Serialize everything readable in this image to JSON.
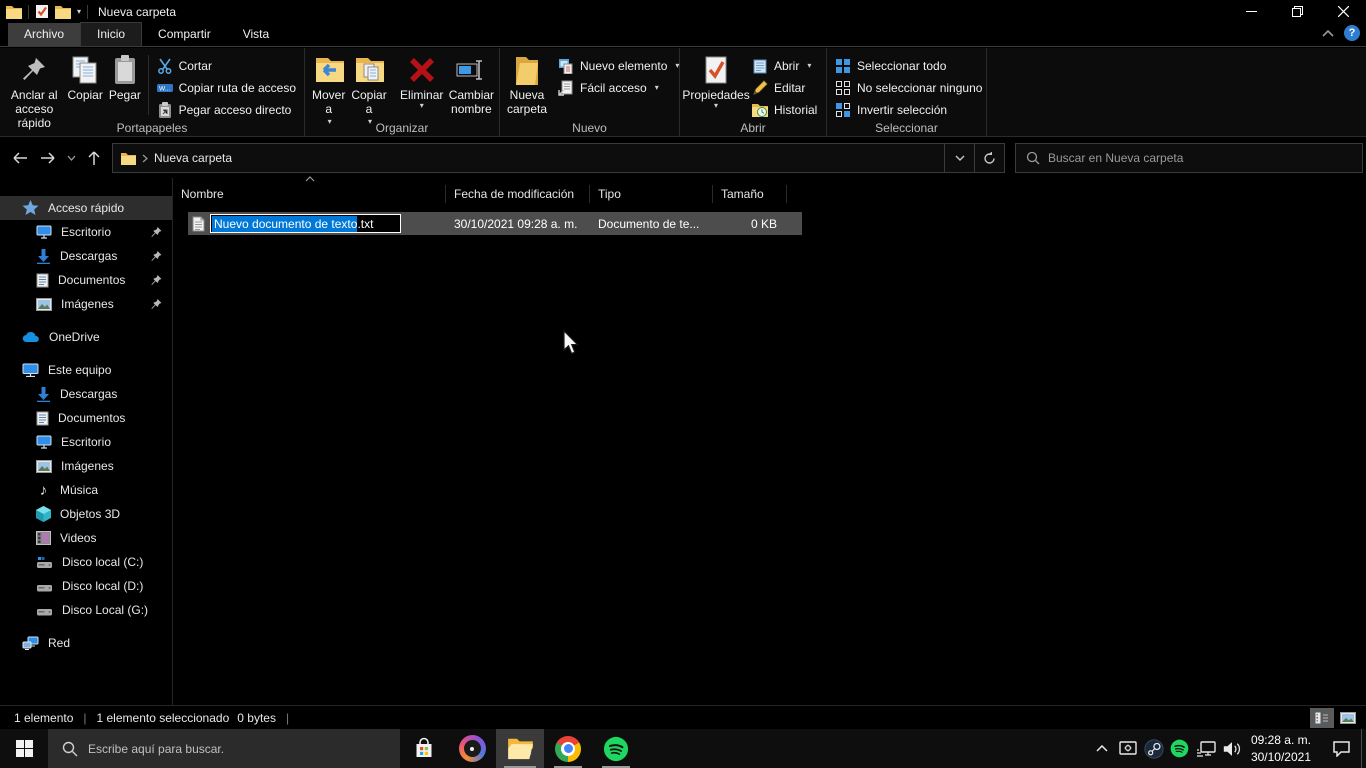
{
  "colors": {
    "accent": "#0078d7",
    "selection_blue": "#0078d7",
    "folder_yellow": "#f3c94f",
    "row_selected_bg": "#4d4d4d",
    "delete_red": "#c1121f"
  },
  "icons": {
    "dropdown_caret": "▾",
    "music_note": "♪",
    "help": "?",
    "close": "✕",
    "minimize": "–"
  },
  "titlebar": {
    "title": "Nueva carpeta"
  },
  "tabs": {
    "archivo": "Archivo",
    "inicio": "Inicio",
    "compartir": "Compartir",
    "vista": "Vista"
  },
  "ribbon": {
    "clipboard": {
      "label": "Portapapeles",
      "pin": "Anclar al acceso rápido",
      "copy": "Copiar",
      "paste": "Pegar",
      "cut": "Cortar",
      "copy_path": "Copiar ruta de acceso",
      "paste_shortcut": "Pegar acceso directo"
    },
    "organize": {
      "label": "Organizar",
      "move_to": "Mover a",
      "copy_to": "Copiar a",
      "delete": "Eliminar",
      "rename": "Cambiar nombre"
    },
    "new": {
      "label": "Nuevo",
      "new_folder": "Nueva carpeta",
      "new_item": "Nuevo elemento",
      "easy_access": "Fácil acceso"
    },
    "open": {
      "label": "Abrir",
      "properties": "Propiedades",
      "open": "Abrir",
      "edit": "Editar",
      "history": "Historial"
    },
    "select": {
      "label": "Seleccionar",
      "select_all": "Seleccionar todo",
      "select_none": "No seleccionar ninguno",
      "invert": "Invertir selección"
    }
  },
  "navbar": {
    "breadcrumb": "Nueva carpeta",
    "search_placeholder": "Buscar en Nueva carpeta"
  },
  "sidebar": {
    "quick_access": "Acceso rápido",
    "qa_items": [
      "Escritorio",
      "Descargas",
      "Documentos",
      "Imágenes"
    ],
    "onedrive": "OneDrive",
    "this_pc": "Este equipo",
    "pc_items": [
      "Descargas",
      "Documentos",
      "Escritorio",
      "Imágenes",
      "Música",
      "Objetos 3D",
      "Videos",
      "Disco local (C:)",
      "Disco local (D:)",
      "Disco Local (G:)"
    ],
    "network": "Red"
  },
  "content": {
    "columns": {
      "name": "Nombre",
      "modified": "Fecha de modificación",
      "type": "Tipo",
      "size": "Tamaño"
    },
    "file": {
      "name": "Nuevo documento de texto",
      "extension": ".txt",
      "modified": "30/10/2021 09:28 a. m.",
      "type": "Documento de te...",
      "size": "0 KB"
    }
  },
  "statusbar": {
    "count": "1 elemento",
    "selected": "1 elemento seleccionado",
    "size": "0 bytes"
  },
  "taskbar": {
    "search_placeholder": "Escribe aquí para buscar.",
    "time": "09:28 a. m.",
    "date": "30/10/2021"
  }
}
